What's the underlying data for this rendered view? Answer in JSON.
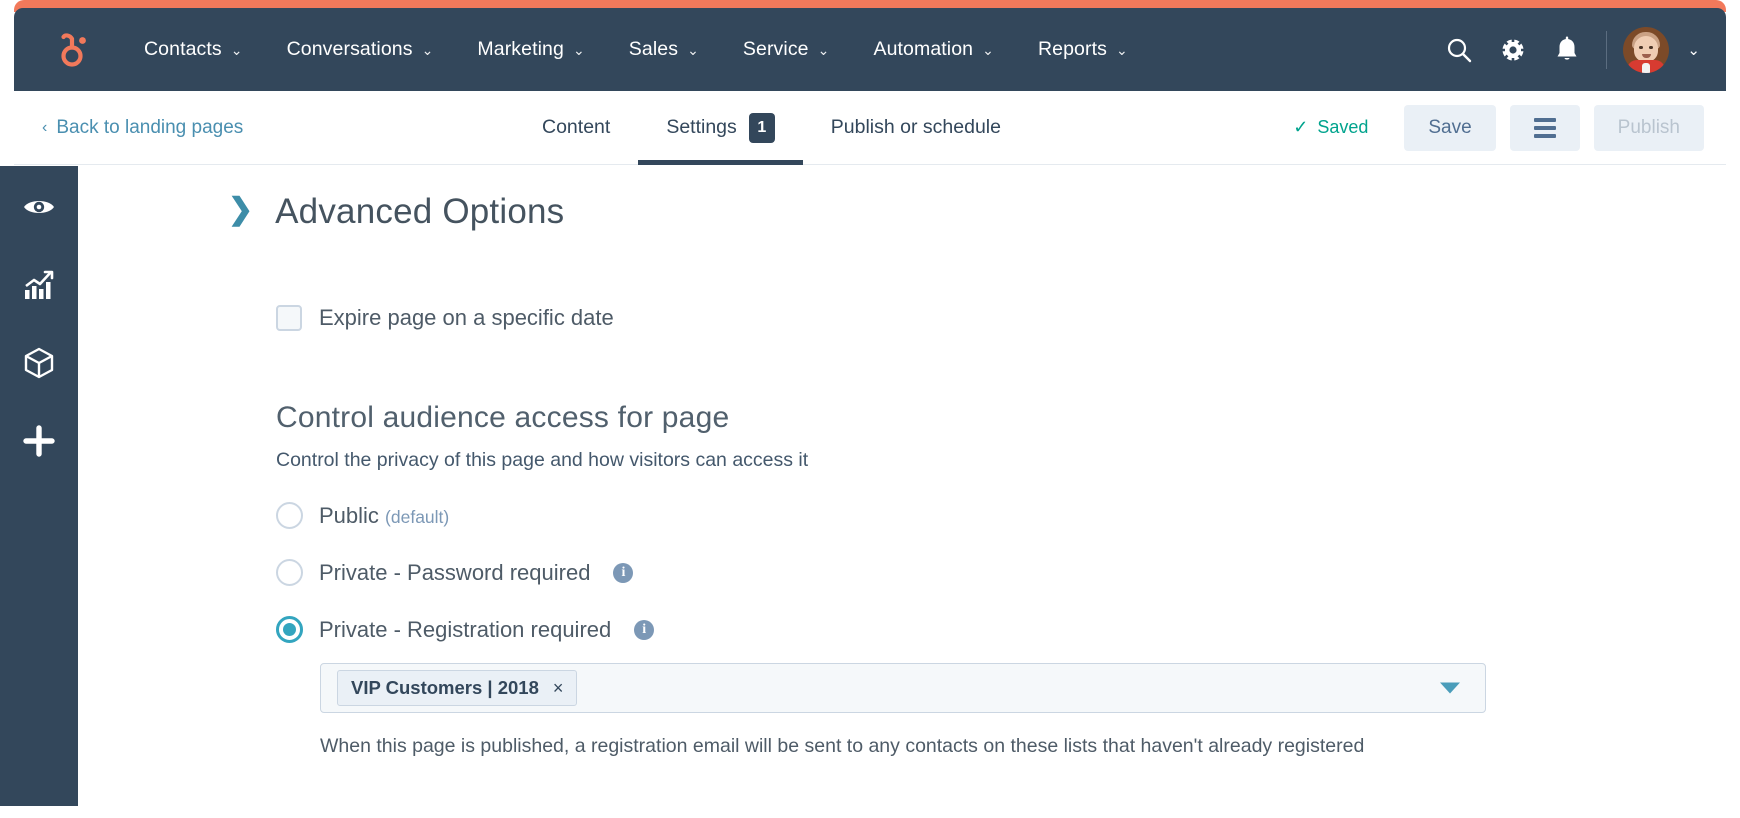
{
  "brand": {
    "logo_icon": "hubspot-sprocket-icon",
    "accent_orange": "#f2795b",
    "navy": "#33475b",
    "teal": "#33a5bf",
    "link_blue": "#4a8fb0",
    "saved_green": "#00a38d"
  },
  "topnav": {
    "items": [
      {
        "label": "Contacts",
        "caret": "⌄"
      },
      {
        "label": "Conversations",
        "caret": "⌄"
      },
      {
        "label": "Marketing",
        "caret": "⌄"
      },
      {
        "label": "Sales",
        "caret": "⌄"
      },
      {
        "label": "Service",
        "caret": "⌄"
      },
      {
        "label": "Automation",
        "caret": "⌄"
      },
      {
        "label": "Reports",
        "caret": "⌄"
      }
    ],
    "icons": [
      "search-icon",
      "settings-gear-icon",
      "notifications-bell-icon"
    ],
    "avatar_caret": "⌄"
  },
  "subbar": {
    "back_label": "Back to landing pages",
    "back_chevron": "‹",
    "tabs": [
      {
        "label": "Content",
        "active": false,
        "badge": null
      },
      {
        "label": "Settings",
        "active": true,
        "badge": "1"
      },
      {
        "label": "Publish or schedule",
        "active": false,
        "badge": null
      }
    ],
    "saved_check": "✓",
    "saved_label": "Saved",
    "save_label": "Save",
    "more_label": "",
    "publish_label": "Publish"
  },
  "rail": {
    "items": [
      {
        "icon": "eye-preview-icon",
        "name": "preview"
      },
      {
        "icon": "analytics-chart-icon",
        "name": "analytics"
      },
      {
        "icon": "module-box-icon",
        "name": "modules"
      },
      {
        "icon": "plus-add-icon",
        "name": "add"
      }
    ]
  },
  "main": {
    "section_chevron": "❯",
    "section_title": "Advanced Options",
    "expire": {
      "label": "Expire page on a specific date",
      "checked": false
    },
    "audience": {
      "heading": "Control audience access for page",
      "description": "Control the privacy of this page and how visitors can access it",
      "options": [
        {
          "label": "Public",
          "suffix": "(default)",
          "selected": false,
          "info": false
        },
        {
          "label": "Private - Password required",
          "suffix": "",
          "selected": false,
          "info": true
        },
        {
          "label": "Private - Registration required",
          "suffix": "",
          "selected": true,
          "info": true
        }
      ],
      "list_select": {
        "tag": "VIP Customers | 2018",
        "remove_glyph": "×",
        "caret_icon": "chevron-down-icon"
      },
      "helper_text": "When this page is published, a registration email will be sent to any contacts on these lists that haven't already registered"
    }
  }
}
